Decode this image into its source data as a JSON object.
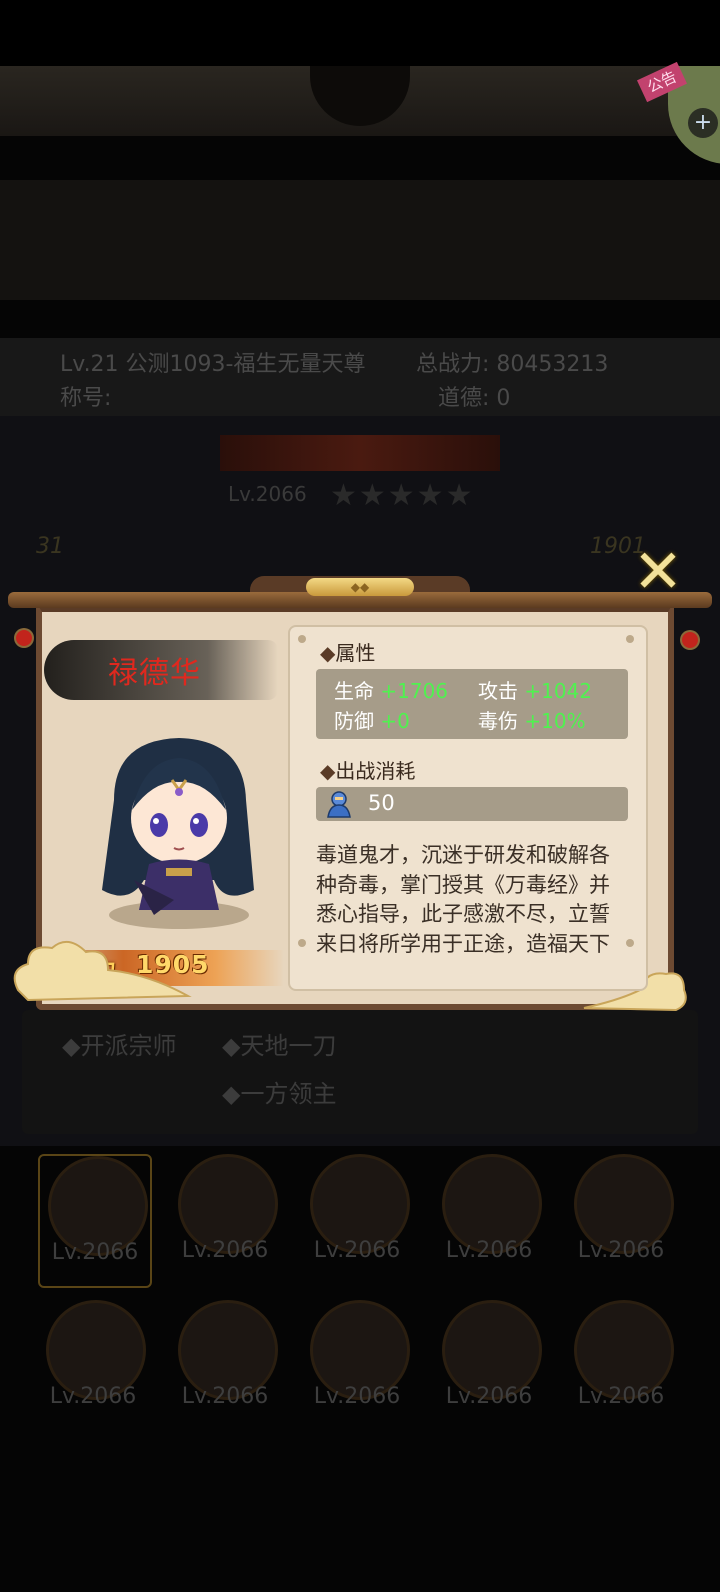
{
  "background": {
    "player": {
      "level_server_name": "Lv.21 公测1093-福生无量天尊",
      "total_power": "总战力: 80453213",
      "title_label": "称号:",
      "morality": "道德: 0"
    },
    "hero_header": {
      "level": "Lv.2066",
      "stars": "★★★★★",
      "left_number": "31",
      "right_number": "1901"
    },
    "skills": [
      "◆开派宗师",
      "◆天地一刀",
      "◆一方领主"
    ],
    "roster": [
      {
        "level": "Lv.2066"
      },
      {
        "level": "Lv.2066"
      },
      {
        "level": "Lv.2066"
      },
      {
        "level": "Lv.2066"
      },
      {
        "level": "Lv.2066"
      },
      {
        "level": "Lv.2066"
      },
      {
        "level": "Lv.2066"
      },
      {
        "level": "Lv.2066"
      },
      {
        "level": "Lv.2066"
      },
      {
        "level": "Lv.2066"
      }
    ],
    "notice_tag": "公告",
    "plus_label": "+"
  },
  "popup": {
    "hero_name": "禄德华",
    "power_label": "战力",
    "power_value": "1905",
    "attributes_title": "属性",
    "attributes": [
      {
        "name": "生命",
        "value": "+1706"
      },
      {
        "name": "攻击",
        "value": "+1042"
      },
      {
        "name": "防御",
        "value": "+0"
      },
      {
        "name": "毒伤",
        "value": "+10%"
      }
    ],
    "cost_title": "出战消耗",
    "cost_value": "50",
    "description_lines": [
      "毒道鬼才，沉迷于研发和破解各",
      "种奇毒，掌门授其《万毒经》并",
      "悉心指导，此子感激不尽，立誓",
      "来日将所学用于正途，造福天下"
    ],
    "close_label": "✕",
    "colors": {
      "attr_value": "#4ff24f",
      "hero_name": "#e0281e",
      "panel": "#e7d6be"
    }
  }
}
